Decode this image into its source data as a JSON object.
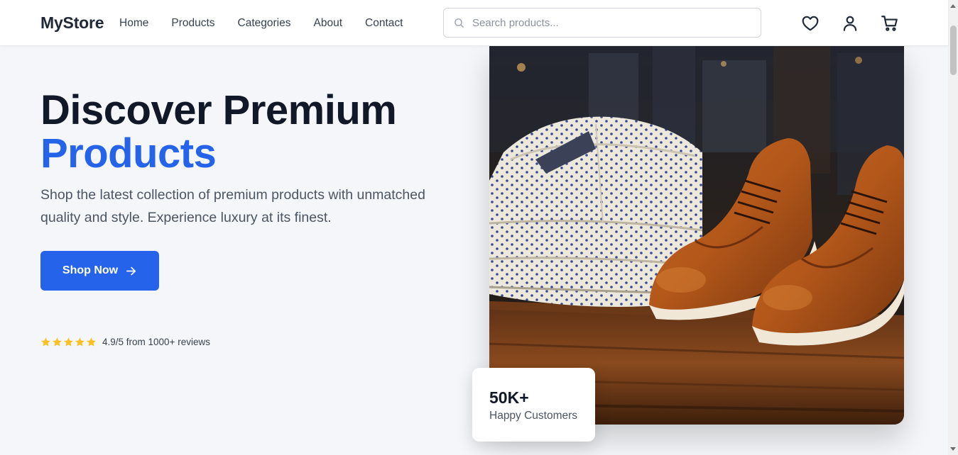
{
  "header": {
    "logo": "MyStore",
    "nav": [
      "Home",
      "Products",
      "Categories",
      "About",
      "Contact"
    ],
    "search_placeholder": "Search products...",
    "icons": [
      "heart-icon",
      "user-icon",
      "cart-icon"
    ]
  },
  "hero": {
    "title_line1": "Discover Premium",
    "title_line2": "Products",
    "subtitle": "Shop the latest collection of premium products with unmatched quality and style. Experience luxury at its finest.",
    "cta_label": "Shop Now",
    "rating": {
      "stars": 5,
      "text": "4.9/5 from 1000+ reviews"
    },
    "stat": {
      "value": "50K+",
      "label": "Happy Customers"
    }
  },
  "colors": {
    "accent": "#2563eb",
    "star": "#fbbf24",
    "heading": "#111827",
    "body_bg": "#f4f6f9"
  }
}
